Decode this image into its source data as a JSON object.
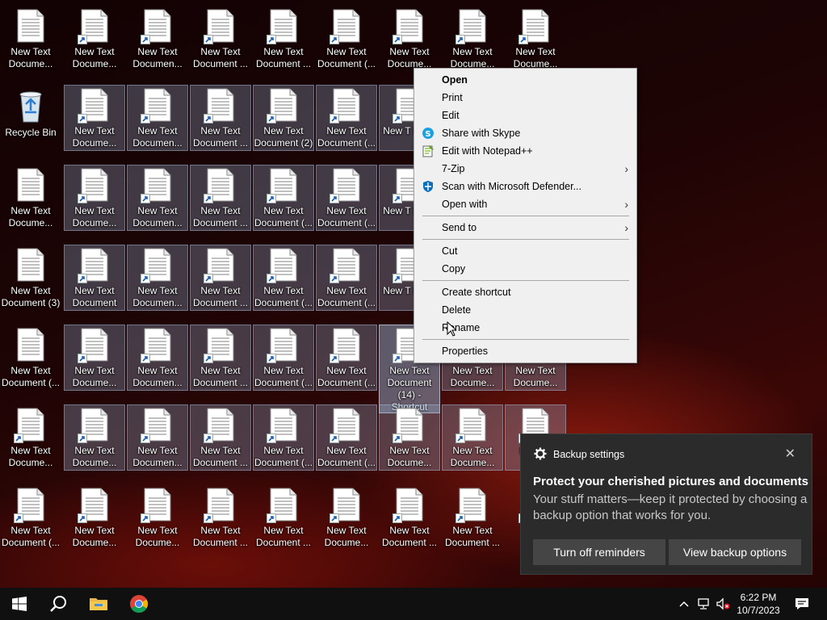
{
  "desktop": {
    "recycle_bin_label": "Recycle Bin",
    "icons": [
      "New Text Docume...",
      "New Text Docume...",
      "New Text Documen...",
      "New Text Document ...",
      "New Text Document ...",
      "New Text Document (...",
      "New Text Docume...",
      "New Text Docume...",
      "New Text Docume...",
      "New Text Docume...",
      "New Text Documen...",
      "New Text Document ...",
      "New Text Document (2)",
      "New Text Document (...",
      "New T Docu",
      "New Text Docume...",
      "New Text Docume...",
      "New Text Documen...",
      "New Text Document ...",
      "New Text Document (...",
      "New Text Document (...",
      "New T Docu",
      "New Text Document (3)",
      "New Text Document",
      "New Text Documen...",
      "New Text Document ...",
      "New Text Document (...",
      "New Text Document (...",
      "New T Docu",
      "New Text Document (...",
      "New Text Docume...",
      "New Text Documen...",
      "New Text Document ...",
      "New Text Document (...",
      "New Text Document (...",
      "New Text Document (14) - Shortcut",
      "New Text Docume...",
      "New Text Docume...",
      "New Text Docume...",
      "New Text Docume...",
      "New Text Documen...",
      "New Text Document ...",
      "New Text Document (...",
      "New Text Document (...",
      "New Text Docume...",
      "New Text Docume...",
      "N Docu",
      "New Text Document (...",
      "New Text Docume...",
      "New Text Docume...",
      "New Text Document ...",
      "New Text Document ...",
      "New Text Docume...",
      "New Text Document ...",
      "New Text Document ...",
      "N Do"
    ]
  },
  "context_menu": {
    "open": "Open",
    "print": "Print",
    "edit": "Edit",
    "share_skype": "Share with Skype",
    "edit_notepad": "Edit with Notepad++",
    "zip": "7-Zip",
    "scan_defender": "Scan with Microsoft Defender...",
    "open_with": "Open with",
    "send_to": "Send to",
    "cut": "Cut",
    "copy": "Copy",
    "create_shortcut": "Create shortcut",
    "delete": "Delete",
    "rename": "Rename",
    "properties": "Properties",
    "arrow": "›"
  },
  "notification": {
    "app_name": "Backup settings",
    "close": "✕",
    "heading": "Protect your cherished pictures and documents",
    "body": "Your stuff matters—keep it protected by choosing a backup option that works for you.",
    "btn_turn_off": "Turn off reminders",
    "btn_view": "View backup options"
  },
  "taskbar": {
    "time": "6:22 PM",
    "date": "10/7/2023"
  },
  "colors": {
    "accent_selection": "#8ca0be",
    "toast_bg": "#2b2b2b",
    "menu_bg": "#f0f0f0"
  }
}
